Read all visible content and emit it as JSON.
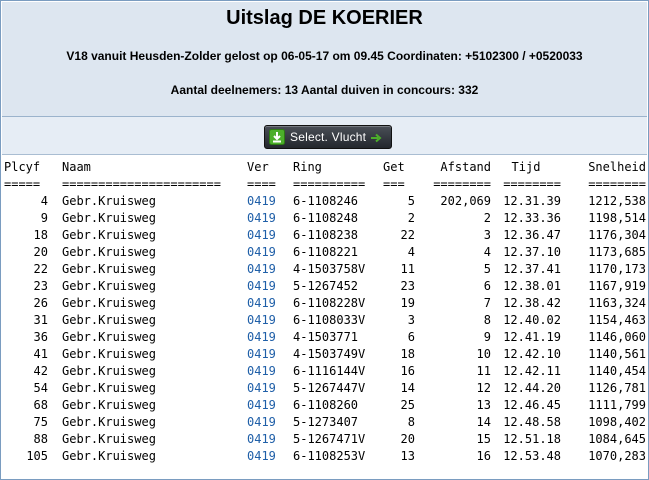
{
  "header": {
    "title": "Uitslag DE KOERIER",
    "subtitle": "V18 vanuit Heusden-Zolder gelost op 06-05-17 om 09.45 Coordinaten: +5102300 / +0520033",
    "counts": "Aantal deelnemers: 13 Aantal duiven in concours: 332"
  },
  "toolbar": {
    "select_label": "Select. Vlucht"
  },
  "table": {
    "headers": [
      "Plcyf",
      "Naam",
      "Ver",
      "Ring",
      "Get",
      "Afstand",
      "Tijd",
      "Snelheid"
    ],
    "separators": [
      "=====",
      "======================",
      "====",
      "==========",
      "===",
      "========",
      "========",
      "========"
    ],
    "rows": [
      [
        "4",
        "Gebr.Kruisweg",
        "0419",
        "6-1108246",
        "5",
        "202,069",
        "12.31.39",
        "1212,538"
      ],
      [
        "9",
        "Gebr.Kruisweg",
        "0419",
        "6-1108248",
        "2",
        "2",
        "12.33.36",
        "1198,514"
      ],
      [
        "18",
        "Gebr.Kruisweg",
        "0419",
        "6-1108238",
        "22",
        "3",
        "12.36.47",
        "1176,304"
      ],
      [
        "20",
        "Gebr.Kruisweg",
        "0419",
        "6-1108221",
        "4",
        "4",
        "12.37.10",
        "1173,685"
      ],
      [
        "22",
        "Gebr.Kruisweg",
        "0419",
        "4-1503758V",
        "11",
        "5",
        "12.37.41",
        "1170,173"
      ],
      [
        "23",
        "Gebr.Kruisweg",
        "0419",
        "5-1267452",
        "23",
        "6",
        "12.38.01",
        "1167,919"
      ],
      [
        "26",
        "Gebr.Kruisweg",
        "0419",
        "6-1108228V",
        "19",
        "7",
        "12.38.42",
        "1163,324"
      ],
      [
        "31",
        "Gebr.Kruisweg",
        "0419",
        "6-1108033V",
        "3",
        "8",
        "12.40.02",
        "1154,463"
      ],
      [
        "36",
        "Gebr.Kruisweg",
        "0419",
        "4-1503771",
        "6",
        "9",
        "12.41.19",
        "1146,060"
      ],
      [
        "41",
        "Gebr.Kruisweg",
        "0419",
        "4-1503749V",
        "18",
        "10",
        "12.42.10",
        "1140,561"
      ],
      [
        "42",
        "Gebr.Kruisweg",
        "0419",
        "6-1116144V",
        "16",
        "11",
        "12.42.11",
        "1140,454"
      ],
      [
        "54",
        "Gebr.Kruisweg",
        "0419",
        "5-1267447V",
        "14",
        "12",
        "12.44.20",
        "1126,781"
      ],
      [
        "68",
        "Gebr.Kruisweg",
        "0419",
        "6-1108260",
        "25",
        "13",
        "12.46.45",
        "1111,799"
      ],
      [
        "75",
        "Gebr.Kruisweg",
        "0419",
        "5-1273407",
        "8",
        "14",
        "12.48.58",
        "1098,402"
      ],
      [
        "88",
        "Gebr.Kruisweg",
        "0419",
        "5-1267471V",
        "20",
        "15",
        "12.51.18",
        "1084,645"
      ],
      [
        "105",
        "Gebr.Kruisweg",
        "0419",
        "6-1108253V",
        "13",
        "16",
        "12.53.48",
        "1070,283"
      ]
    ]
  }
}
